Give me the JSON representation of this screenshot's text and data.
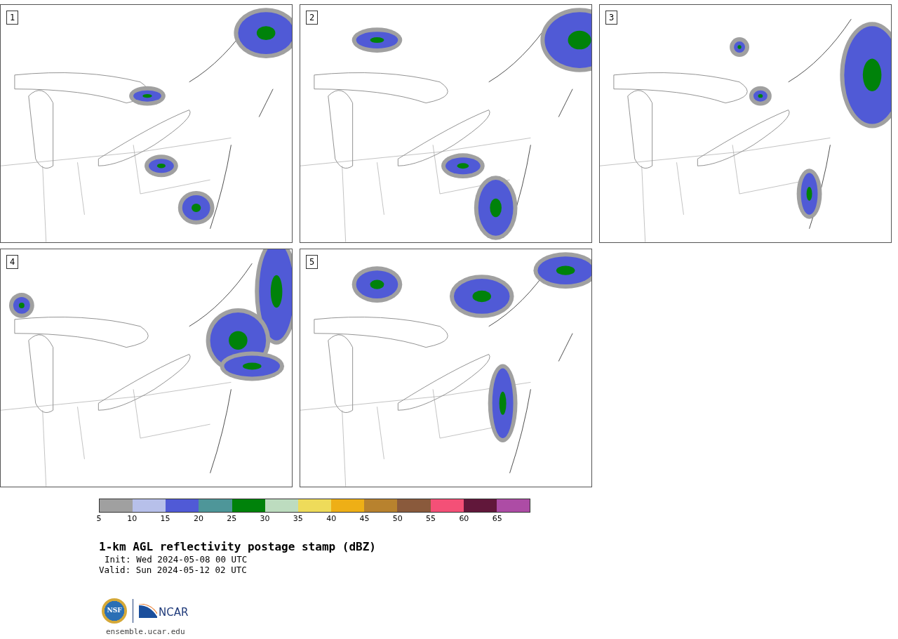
{
  "panels": [
    {
      "label": "1"
    },
    {
      "label": "2"
    },
    {
      "label": "3"
    },
    {
      "label": "4"
    },
    {
      "label": "5"
    }
  ],
  "colorbar": {
    "bins": [
      {
        "color": "#a0a0a0"
      },
      {
        "color": "#b7c0ea"
      },
      {
        "color": "#505ad6"
      },
      {
        "color": "#4e9699"
      },
      {
        "color": "#00820a"
      },
      {
        "color": "#bddcbf"
      },
      {
        "color": "#eedb5a"
      },
      {
        "color": "#eeaf16"
      },
      {
        "color": "#b8822e"
      },
      {
        "color": "#8a5a3c"
      },
      {
        "color": "#f45077"
      },
      {
        "color": "#61173a"
      },
      {
        "color": "#ad4ca5"
      }
    ],
    "ticks": [
      "5",
      "10",
      "15",
      "20",
      "25",
      "30",
      "35",
      "40",
      "45",
      "50",
      "55",
      "60",
      "65"
    ]
  },
  "title": "1-km AGL reflectivity postage stamp (dBZ)",
  "init": "Init: Wed 2024-05-08 00 UTC",
  "valid": "Valid: Sun 2024-05-12 02 UTC",
  "logo": {
    "left": "NSF",
    "right": "NCAR"
  },
  "footer": "ensemble.ucar.edu"
}
